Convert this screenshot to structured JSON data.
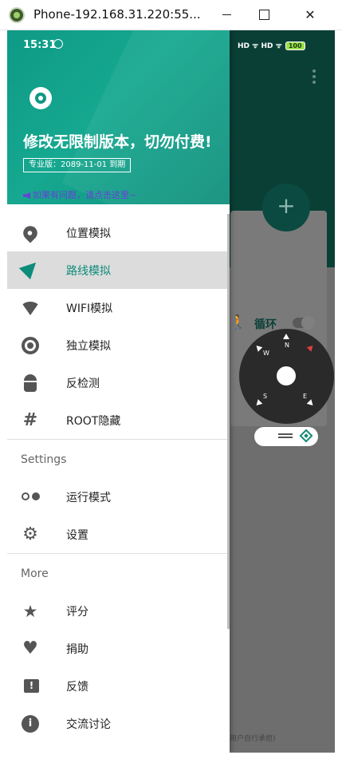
{
  "window": {
    "title": "Phone-192.168.31.220:55...",
    "min_label": "",
    "max_label": "",
    "close_label": "✕"
  },
  "status_bar": {
    "time": "15:31",
    "right_text": "HD ᯤ HD ᯤ",
    "battery": "100"
  },
  "drawer": {
    "title": "修改无限制版本，切勿付费!",
    "license": "专业版：2089-11-01 到期",
    "promo": "如果有问题，请点击这里~",
    "items": [
      {
        "label": "位置模拟",
        "icon": "location-pin-icon"
      },
      {
        "label": "路线模拟",
        "icon": "navigation-arrow-icon",
        "active": true
      },
      {
        "label": "WIFI模拟",
        "icon": "wifi-icon"
      },
      {
        "label": "独立模拟",
        "icon": "disc-icon"
      },
      {
        "label": "反检测",
        "icon": "android-icon"
      },
      {
        "label": "ROOT隐藏",
        "icon": "hash-icon"
      }
    ],
    "settings_header": "Settings",
    "settings_items": [
      {
        "label": "运行模式",
        "icon": "toggle-mode-icon"
      },
      {
        "label": "设置",
        "icon": "gear-icon"
      }
    ],
    "more_header": "More",
    "more_items": [
      {
        "label": "评分",
        "icon": "star-icon"
      },
      {
        "label": "捐助",
        "icon": "heart-icon"
      },
      {
        "label": "反馈",
        "icon": "feedback-icon"
      },
      {
        "label": "交流讨论",
        "icon": "info-icon"
      }
    ]
  },
  "background_app": {
    "fab_label": "+",
    "loop_label": "循环",
    "compass_dirs": [
      "N",
      "E",
      "S",
      "W"
    ],
    "bottom_text": "用户自行承担)"
  },
  "colors": {
    "accent": "#0e8c7a",
    "header": "#16a890",
    "promo": "#6a3fd8"
  }
}
